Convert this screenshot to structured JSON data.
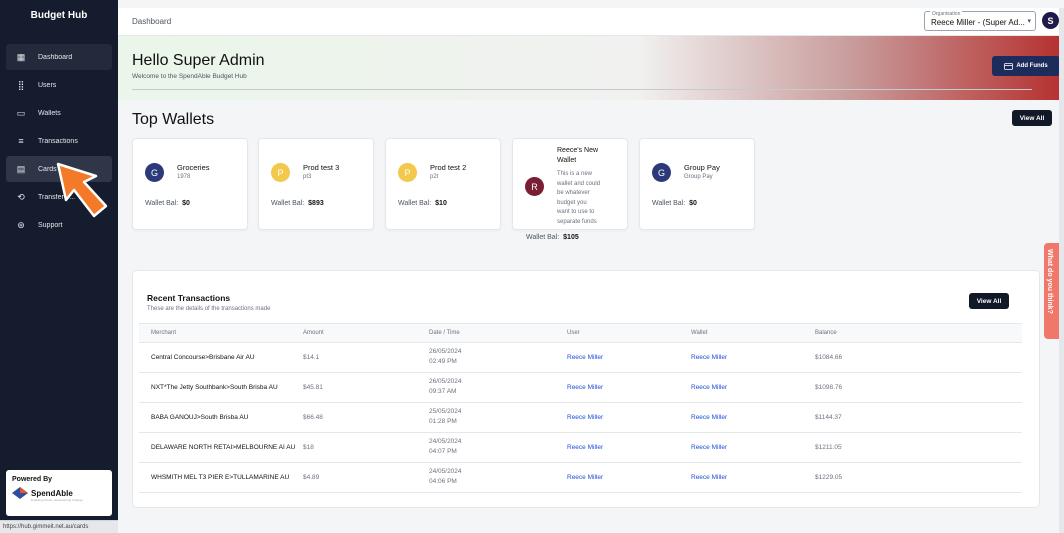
{
  "app": {
    "brand": "Budget Hub"
  },
  "sidebar": {
    "items": [
      {
        "label": "Dashboard",
        "icon": "dashboard-icon",
        "glyph": "▦"
      },
      {
        "label": "Users",
        "icon": "users-icon",
        "glyph": "⣿"
      },
      {
        "label": "Wallets",
        "icon": "wallet-icon",
        "glyph": "▭"
      },
      {
        "label": "Transactions",
        "icon": "transactions-icon",
        "glyph": "≡"
      },
      {
        "label": "Cards",
        "icon": "card-icon",
        "glyph": "▤"
      },
      {
        "label": "Transfer F...",
        "icon": "transfer-icon",
        "glyph": "⟲"
      },
      {
        "label": "Support",
        "icon": "support-icon",
        "glyph": "⊛"
      }
    ],
    "powered_by": "Powered By",
    "logo_text": "SpendAble",
    "logo_tagline": "Enabling Choice, Empowering Change",
    "status_url": "https://hub.gimmeit.net.au/cards"
  },
  "topbar": {
    "title": "Dashboard",
    "org_label": "Organisation",
    "org_value": "Reece Miller - (Super Ad...",
    "avatar": "S"
  },
  "hero": {
    "title": "Hello Super Admin",
    "subtitle": "Welcome to the SpendAble Budget Hub",
    "add_funds": "Add Funds"
  },
  "wallets": {
    "title": "Top Wallets",
    "view_all": "View All",
    "balance_label": "Wallet Bal:",
    "items": [
      {
        "initial": "G",
        "name": "Groceries",
        "code": "1978",
        "balance": "$0",
        "color": "#2d3a7a"
      },
      {
        "initial": "P",
        "name": "Prod test 3",
        "code": "pt3",
        "balance": "$893",
        "color": "#f2c94c"
      },
      {
        "initial": "P",
        "name": "Prod test 2",
        "code": "p2t",
        "balance": "$10",
        "color": "#f2c94c"
      },
      {
        "initial": "R",
        "name_line1": "Reece's New",
        "name_line2": "Wallet",
        "desc": [
          "This is a new",
          "wallet and could",
          "be whatever",
          "budget you",
          "want to use to",
          "separate funds"
        ],
        "balance": "$105",
        "color": "#7a1e34"
      },
      {
        "initial": "G",
        "name": "Group Pay",
        "code": "Group Pay",
        "balance": "$0",
        "color": "#2d3a7a"
      }
    ]
  },
  "feedback": {
    "label": "What do you think?"
  },
  "transactions": {
    "title": "Recent Transactions",
    "subtitle": "These are the details of the transactions made",
    "view_all": "View All",
    "columns": [
      "Merchant",
      "Amount",
      "Date / Time",
      "User",
      "Wallet",
      "Balance"
    ],
    "rows": [
      {
        "merchant": "Central Concourse>Brisbane Air AU",
        "amount": "$14.1",
        "date": "26/05/2024",
        "time": "02:49 PM",
        "user": "Reece Miller",
        "wallet": "Reece Miller",
        "balance": "$1084.66"
      },
      {
        "merchant": "NXT*The Jetty Southbank>South Brisba AU",
        "amount": "$45.81",
        "date": "26/05/2024",
        "time": "09:37 AM",
        "user": "Reece Miller",
        "wallet": "Reece Miller",
        "balance": "$1098.76"
      },
      {
        "merchant": "BABA GANOUJ>South Brisba AU",
        "amount": "$66.48",
        "date": "25/05/2024",
        "time": "01:28 PM",
        "user": "Reece Miller",
        "wallet": "Reece Miller",
        "balance": "$1144.37"
      },
      {
        "merchant": "DELAWARE NORTH RETAI>MELBOURNE AI AU",
        "amount": "$18",
        "date": "24/05/2024",
        "time": "04:07 PM",
        "user": "Reece Miller",
        "wallet": "Reece Miller",
        "balance": "$1211.05"
      },
      {
        "merchant": "WHSMITH MEL T3 PIER E>TULLAMARINE AU",
        "amount": "$4.89",
        "date": "24/05/2024",
        "time": "04:06 PM",
        "user": "Reece Miller",
        "wallet": "Reece Miller",
        "balance": "$1229.05"
      }
    ]
  }
}
